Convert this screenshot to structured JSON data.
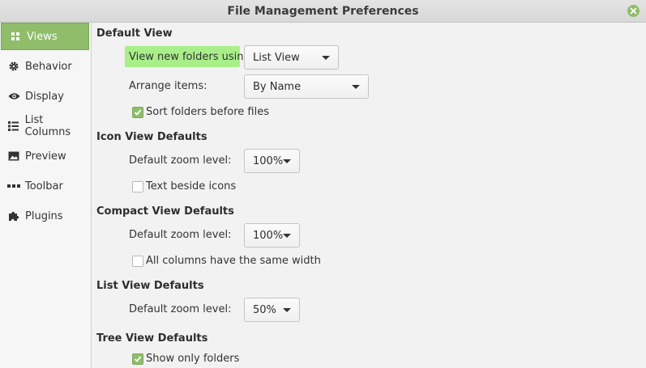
{
  "window": {
    "title": "File Management Preferences",
    "close_icon": "close-icon"
  },
  "colors": {
    "accent": "#8fbd6a",
    "highlight": "#a9ef89"
  },
  "sidebar": {
    "items": [
      {
        "label": "Views",
        "icon": "grid-icon",
        "active": true
      },
      {
        "label": "Behavior",
        "icon": "gear-icon",
        "active": false
      },
      {
        "label": "Display",
        "icon": "eye-icon",
        "active": false
      },
      {
        "label": "List Columns",
        "icon": "list-columns-icon",
        "active": false
      },
      {
        "label": "Preview",
        "icon": "image-icon",
        "active": false
      },
      {
        "label": "Toolbar",
        "icon": "dots-icon",
        "active": false
      },
      {
        "label": "Plugins",
        "icon": "puzzle-icon",
        "active": false
      }
    ]
  },
  "default_view": {
    "heading": "Default View",
    "view_new_folders_label": "View new folders using:",
    "view_new_folders_value": "List View",
    "arrange_label": "Arrange items:",
    "arrange_value": "By Name",
    "sort_folders_label": "Sort folders before files",
    "sort_folders_checked": true
  },
  "icon_view": {
    "heading": "Icon View Defaults",
    "zoom_label": "Default zoom level:",
    "zoom_value": "100%",
    "text_beside_label": "Text beside icons",
    "text_beside_checked": false
  },
  "compact_view": {
    "heading": "Compact View Defaults",
    "zoom_label": "Default zoom level:",
    "zoom_value": "100%",
    "same_width_label": "All columns have the same width",
    "same_width_checked": false
  },
  "list_view": {
    "heading": "List View Defaults",
    "zoom_label": "Default zoom level:",
    "zoom_value": "50%"
  },
  "tree_view": {
    "heading": "Tree View Defaults",
    "only_folders_label": "Show only folders",
    "only_folders_checked": true
  }
}
